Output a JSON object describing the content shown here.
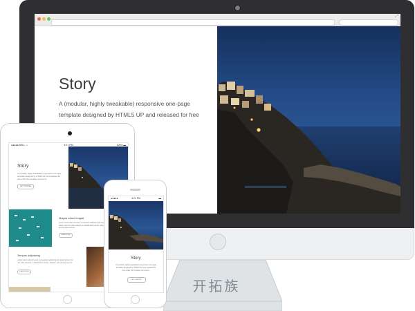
{
  "imac": {
    "page": {
      "title": "Story",
      "description": "A (modular, highly tweakable) responsive one-page template designed by HTML5 UP and released for free"
    }
  },
  "ipad": {
    "status": {
      "carrier": "●●●●● BELL ☆",
      "time": "4:21 PM",
      "battery": "100% ▬"
    },
    "hero": {
      "title": "Story",
      "description": "A (modular, highly tweakable) responsive one-page template designed by HTML5 UP and released for free under the Creative Commons.",
      "button": "GET STARTED"
    },
    "section2": {
      "title": "Magna etiam feugiat",
      "description": "Lorem ipsum dolor sit amet, consectetur adipiscing elit. Etiam dictum nisl non nulla vehicula, in blandit libero luctus. Aliquam erat volutpat sed nisi.",
      "button": "LEARN MORE"
    },
    "section3": {
      "title": "Tempus adipiscing",
      "description": "Lorem ipsum dolor sit amet, consectetur adipiscing elit. Etiam dictum nisl non nulla vehicula, in blandit libero luctus. Aliquam erat volutpat sed nisi.",
      "button": "LEARN MORE"
    }
  },
  "iphone": {
    "status": {
      "carrier": "●●●●●",
      "time": "4:21 PM",
      "battery": "▬"
    },
    "hero": {
      "title": "Story",
      "description": "A (modular, highly tweakable) responsive one-page template designed by HTML5 UP and released for free under the Creative Commons.",
      "button": "GET STARTED"
    }
  },
  "stand_text": "开拓族",
  "colors": {
    "bezel": "#2f2f31",
    "night_sky": "#234a86",
    "device_border": "#c9ced2"
  }
}
